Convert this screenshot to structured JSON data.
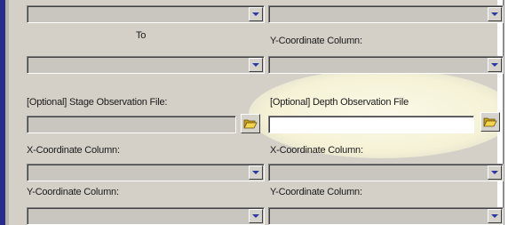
{
  "labels": {
    "to": "To",
    "y_coord_top": "Y-Coordinate Column:",
    "stage_obs_file": "[Optional] Stage Observation File:",
    "depth_obs_file": "[Optional] Depth Observation File",
    "x_coord_left": "X-Coordinate Column:",
    "x_coord_right": "X-Coordinate Column:",
    "y_coord_left": "Y-Coordinate Column:",
    "y_coord_right": "Y-Coordinate Column:"
  },
  "fields": {
    "depth_obs_file_value": "",
    "stage_obs_file_value": ""
  },
  "icons": {
    "folder": "folder-open-icon",
    "dropdown": "chevron-down-icon"
  },
  "colors": {
    "accent_left_border": "#2a2a8c",
    "panel_bg": "#d4d0c8",
    "highlight": "#f5f2d6"
  }
}
